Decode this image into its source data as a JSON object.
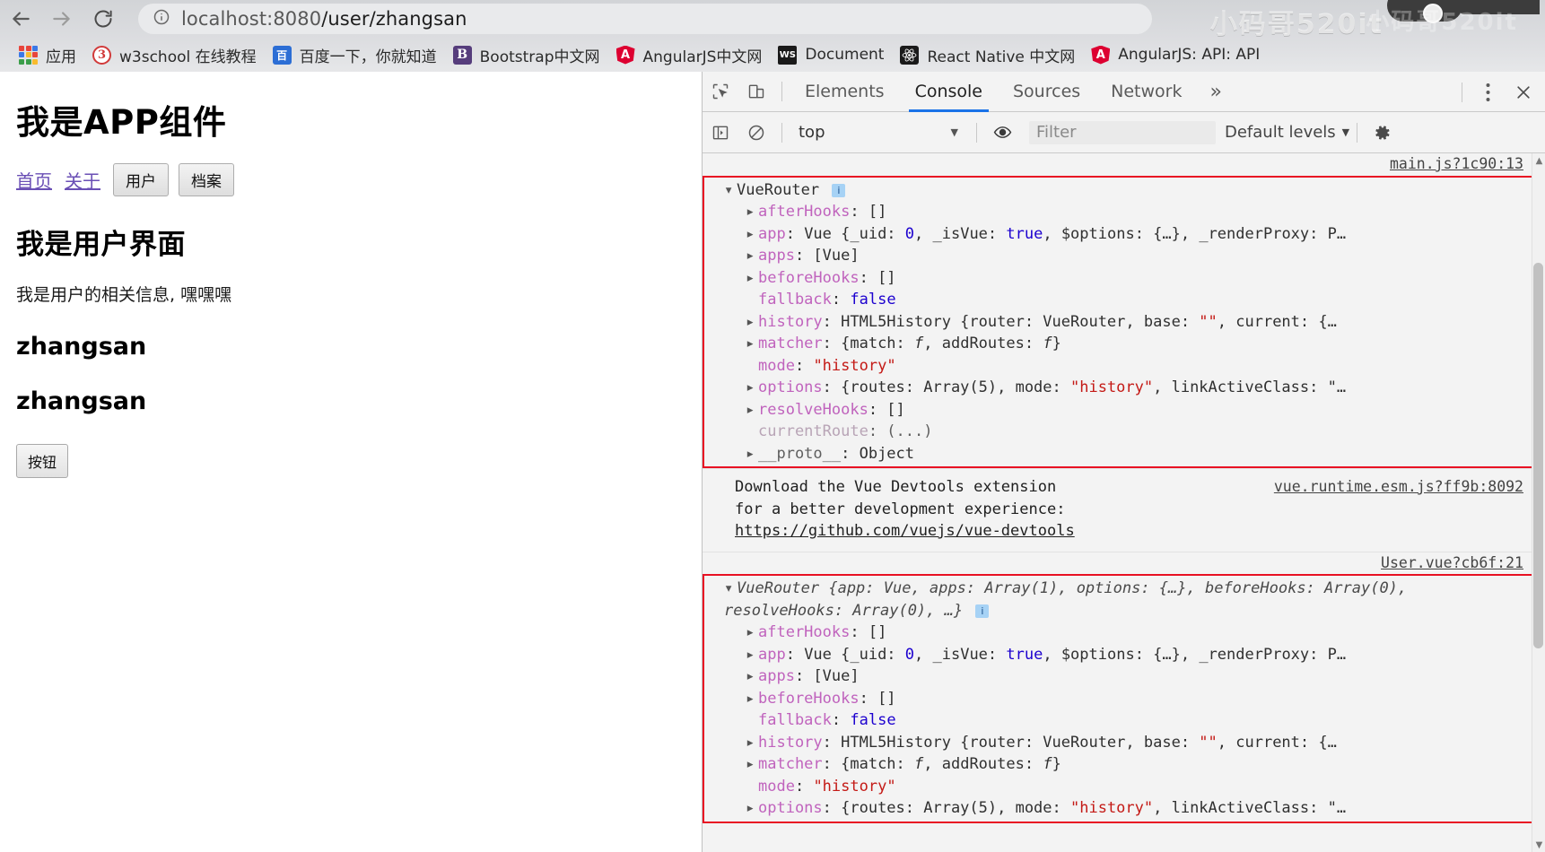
{
  "browser": {
    "nav": {
      "back": "back-arrow",
      "forward": "forward-arrow",
      "reload": "reload"
    },
    "url_prefix": "localhost:8080",
    "url_suffix": "/user/zhangsan",
    "watermark": "小码哥520it",
    "watermark2": "小码哥520it",
    "bookmarks": [
      {
        "label": "应用",
        "icon": "apps-grid-icon"
      },
      {
        "label": "w3school 在线教程",
        "icon": "w3school-icon",
        "glyph": "3"
      },
      {
        "label": "百度一下，你就知道",
        "icon": "baidu-icon",
        "glyph": "百"
      },
      {
        "label": "Bootstrap中文网",
        "icon": "bootstrap-icon",
        "glyph": "B"
      },
      {
        "label": "AngularJS中文网",
        "icon": "angular-icon",
        "glyph": "A"
      },
      {
        "label": "Document",
        "icon": "ws-icon",
        "glyph": "WS"
      },
      {
        "label": "React Native 中文网",
        "icon": "react-icon",
        "glyph": "⚛"
      },
      {
        "label": "AngularJS: API: API",
        "icon": "angular-icon",
        "glyph": "A"
      }
    ]
  },
  "page": {
    "app_title": "我是APP组件",
    "links": [
      {
        "label": "首页",
        "type": "link"
      },
      {
        "label": "关于",
        "type": "link"
      },
      {
        "label": "用户",
        "type": "button"
      },
      {
        "label": "档案",
        "type": "button"
      }
    ],
    "user_title": "我是用户界面",
    "user_desc": "我是用户的相关信息, 嘿嘿嘿",
    "name_1": "zhangsan",
    "name_2": "zhangsan",
    "button_label": "按钮"
  },
  "devtools": {
    "tabs": [
      {
        "label": "Elements",
        "active": false
      },
      {
        "label": "Console",
        "active": true
      },
      {
        "label": "Sources",
        "active": false
      },
      {
        "label": "Network",
        "active": false
      }
    ],
    "more_tabs": "»",
    "menu_icon": "kebab-menu-icon",
    "close_icon": "close-icon",
    "inspect_icon": "inspect-element-icon",
    "device_icon": "device-toolbar-icon",
    "sidebar_icon": "console-sidebar-icon",
    "clear_icon": "clear-console-icon",
    "eye_icon": "live-expression-icon",
    "settings_icon": "settings-gear-icon",
    "context": "top",
    "filter_placeholder": "Filter",
    "levels": "Default levels"
  },
  "console": {
    "messages": [
      {
        "source": "main.js?1c90:13",
        "boxed": true,
        "lines": [
          {
            "indent": 0,
            "arrow": "down",
            "parts": [
              {
                "t": "VueRouter ",
                "c": "plain"
              }
            ],
            "badge": true
          },
          {
            "indent": 1,
            "arrow": "right",
            "parts": [
              {
                "t": "afterHooks",
                "c": "prop"
              },
              {
                "t": ": ",
                "c": "plain"
              },
              {
                "t": "[]",
                "c": "plain"
              }
            ]
          },
          {
            "indent": 1,
            "arrow": "right",
            "parts": [
              {
                "t": "app",
                "c": "prop"
              },
              {
                "t": ": Vue {_uid: ",
                "c": "plain"
              },
              {
                "t": "0",
                "c": "num"
              },
              {
                "t": ", _isVue: ",
                "c": "plain"
              },
              {
                "t": "true",
                "c": "bool"
              },
              {
                "t": ", $options: {…}, _renderProxy: P…",
                "c": "plain"
              }
            ]
          },
          {
            "indent": 1,
            "arrow": "right",
            "parts": [
              {
                "t": "apps",
                "c": "prop"
              },
              {
                "t": ": [Vue]",
                "c": "plain"
              }
            ]
          },
          {
            "indent": 1,
            "arrow": "right",
            "parts": [
              {
                "t": "beforeHooks",
                "c": "prop"
              },
              {
                "t": ": []",
                "c": "plain"
              }
            ]
          },
          {
            "indent": 1,
            "arrow": "blank",
            "parts": [
              {
                "t": "fallback",
                "c": "prop"
              },
              {
                "t": ": ",
                "c": "plain"
              },
              {
                "t": "false",
                "c": "bool"
              }
            ]
          },
          {
            "indent": 1,
            "arrow": "right",
            "parts": [
              {
                "t": "history",
                "c": "prop"
              },
              {
                "t": ": HTML5History {router: VueRouter, base: ",
                "c": "plain"
              },
              {
                "t": "\"\"",
                "c": "str"
              },
              {
                "t": ", current: {…",
                "c": "plain"
              }
            ]
          },
          {
            "indent": 1,
            "arrow": "right",
            "parts": [
              {
                "t": "matcher",
                "c": "prop"
              },
              {
                "t": ": {match: ",
                "c": "plain"
              },
              {
                "t": "f",
                "c": "fn"
              },
              {
                "t": ", addRoutes: ",
                "c": "plain"
              },
              {
                "t": "f",
                "c": "fn"
              },
              {
                "t": "}",
                "c": "plain"
              }
            ]
          },
          {
            "indent": 1,
            "arrow": "blank",
            "parts": [
              {
                "t": "mode",
                "c": "prop"
              },
              {
                "t": ": ",
                "c": "plain"
              },
              {
                "t": "\"history\"",
                "c": "str"
              }
            ]
          },
          {
            "indent": 1,
            "arrow": "right",
            "parts": [
              {
                "t": "options",
                "c": "prop"
              },
              {
                "t": ": {routes: Array(5), mode: ",
                "c": "plain"
              },
              {
                "t": "\"history\"",
                "c": "str"
              },
              {
                "t": ", linkActiveClass: \"…",
                "c": "plain"
              }
            ]
          },
          {
            "indent": 1,
            "arrow": "right",
            "parts": [
              {
                "t": "resolveHooks",
                "c": "prop"
              },
              {
                "t": ": []",
                "c": "plain"
              }
            ]
          },
          {
            "indent": 1,
            "arrow": "blank",
            "parts": [
              {
                "t": "currentRoute",
                "c": "propd"
              },
              {
                "t": ": (...)",
                "c": "dim"
              }
            ]
          },
          {
            "indent": 1,
            "arrow": "right",
            "parts": [
              {
                "t": "__proto__",
                "c": "dim"
              },
              {
                "t": ": Object",
                "c": "plain"
              }
            ]
          }
        ]
      },
      {
        "source": "vue.runtime.esm.js?ff9b:8092",
        "boxed": false,
        "plain": [
          "Download the Vue Devtools extension",
          "for a better development experience:",
          "https://github.com/vuejs/vue-devtools"
        ]
      },
      {
        "source": "User.vue?cb6f:21",
        "boxed": true,
        "lines": [
          {
            "indent": 0,
            "arrow": "down",
            "wrap": true,
            "parts": [
              {
                "t": "VueRouter {app: Vue, apps: Array(1), options: {…}, beforeHooks: Array(0), resolveHooks: Array(0), …} ",
                "c": "ital"
              }
            ],
            "badge": true
          },
          {
            "indent": 1,
            "arrow": "right",
            "parts": [
              {
                "t": "afterHooks",
                "c": "prop"
              },
              {
                "t": ": []",
                "c": "plain"
              }
            ]
          },
          {
            "indent": 1,
            "arrow": "right",
            "parts": [
              {
                "t": "app",
                "c": "prop"
              },
              {
                "t": ": Vue {_uid: ",
                "c": "plain"
              },
              {
                "t": "0",
                "c": "num"
              },
              {
                "t": ", _isVue: ",
                "c": "plain"
              },
              {
                "t": "true",
                "c": "bool"
              },
              {
                "t": ", $options: {…}, _renderProxy: P…",
                "c": "plain"
              }
            ]
          },
          {
            "indent": 1,
            "arrow": "right",
            "parts": [
              {
                "t": "apps",
                "c": "prop"
              },
              {
                "t": ": [Vue]",
                "c": "plain"
              }
            ]
          },
          {
            "indent": 1,
            "arrow": "right",
            "parts": [
              {
                "t": "beforeHooks",
                "c": "prop"
              },
              {
                "t": ": []",
                "c": "plain"
              }
            ]
          },
          {
            "indent": 1,
            "arrow": "blank",
            "parts": [
              {
                "t": "fallback",
                "c": "prop"
              },
              {
                "t": ": ",
                "c": "plain"
              },
              {
                "t": "false",
                "c": "bool"
              }
            ]
          },
          {
            "indent": 1,
            "arrow": "right",
            "parts": [
              {
                "t": "history",
                "c": "prop"
              },
              {
                "t": ": HTML5History {router: VueRouter, base: ",
                "c": "plain"
              },
              {
                "t": "\"\"",
                "c": "str"
              },
              {
                "t": ", current: {…",
                "c": "plain"
              }
            ]
          },
          {
            "indent": 1,
            "arrow": "right",
            "parts": [
              {
                "t": "matcher",
                "c": "prop"
              },
              {
                "t": ": {match: ",
                "c": "plain"
              },
              {
                "t": "f",
                "c": "fn"
              },
              {
                "t": ", addRoutes: ",
                "c": "plain"
              },
              {
                "t": "f",
                "c": "fn"
              },
              {
                "t": "}",
                "c": "plain"
              }
            ]
          },
          {
            "indent": 1,
            "arrow": "blank",
            "parts": [
              {
                "t": "mode",
                "c": "prop"
              },
              {
                "t": ": ",
                "c": "plain"
              },
              {
                "t": "\"history\"",
                "c": "str"
              }
            ]
          },
          {
            "indent": 1,
            "arrow": "right",
            "parts": [
              {
                "t": "options",
                "c": "prop"
              },
              {
                "t": ": {routes: Array(5), mode: ",
                "c": "plain"
              },
              {
                "t": "\"history\"",
                "c": "str"
              },
              {
                "t": ", linkActiveClass: \"…",
                "c": "plain"
              }
            ]
          }
        ]
      }
    ]
  },
  "colors": {
    "accent": "#1a73e8",
    "highlight_box": "#e81123",
    "string": "#c41a16",
    "property": "#c063bd",
    "number": "#1c00cf"
  }
}
